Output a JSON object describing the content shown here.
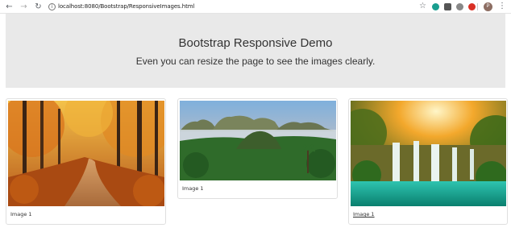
{
  "browser": {
    "url": "localhost:8080/Bootstrap/ResponsiveImages.html",
    "avatar_letter": "P"
  },
  "jumbotron": {
    "title": "Bootstrap Responsive Demo",
    "subtitle": "Even you can resize the page to see the images clearly."
  },
  "cards": [
    {
      "caption": "Image 1",
      "image": "autumn-forest-road"
    },
    {
      "caption": "Image 1",
      "image": "mountain-valley-landscape"
    },
    {
      "caption": "Image 1",
      "image": "waterfall-lagoon"
    }
  ],
  "colors": {
    "jumbotron_bg": "#e9e9e9",
    "card_border": "#dfdfdf"
  }
}
